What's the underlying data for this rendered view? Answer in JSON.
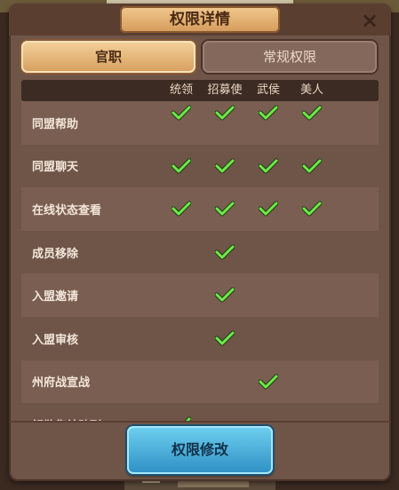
{
  "dialog": {
    "title": "权限详情",
    "close_icon": "×",
    "tabs": [
      {
        "label": "官职",
        "active": true
      },
      {
        "label": "常规权限",
        "active": false
      }
    ],
    "columns": [
      "统领",
      "招募使",
      "武侯",
      "美人"
    ],
    "rows": [
      {
        "label": "同盟帮助",
        "checks": [
          true,
          true,
          true,
          true
        ]
      },
      {
        "label": "同盟聊天",
        "checks": [
          true,
          true,
          true,
          true
        ]
      },
      {
        "label": "在线状态查看",
        "checks": [
          true,
          true,
          true,
          true
        ]
      },
      {
        "label": "成员移除",
        "checks": [
          false,
          true,
          false,
          false
        ]
      },
      {
        "label": "入盟邀请",
        "checks": [
          false,
          true,
          false,
          false
        ]
      },
      {
        "label": "入盟审核",
        "checks": [
          false,
          true,
          false,
          false
        ]
      },
      {
        "label": "州府战宣战",
        "checks": [
          false,
          false,
          true,
          false
        ]
      },
      {
        "label": "解散集结队列",
        "checks": [
          true,
          false,
          false,
          false
        ]
      }
    ],
    "action_button": "权限修改",
    "check_color": "#6ee84a"
  }
}
